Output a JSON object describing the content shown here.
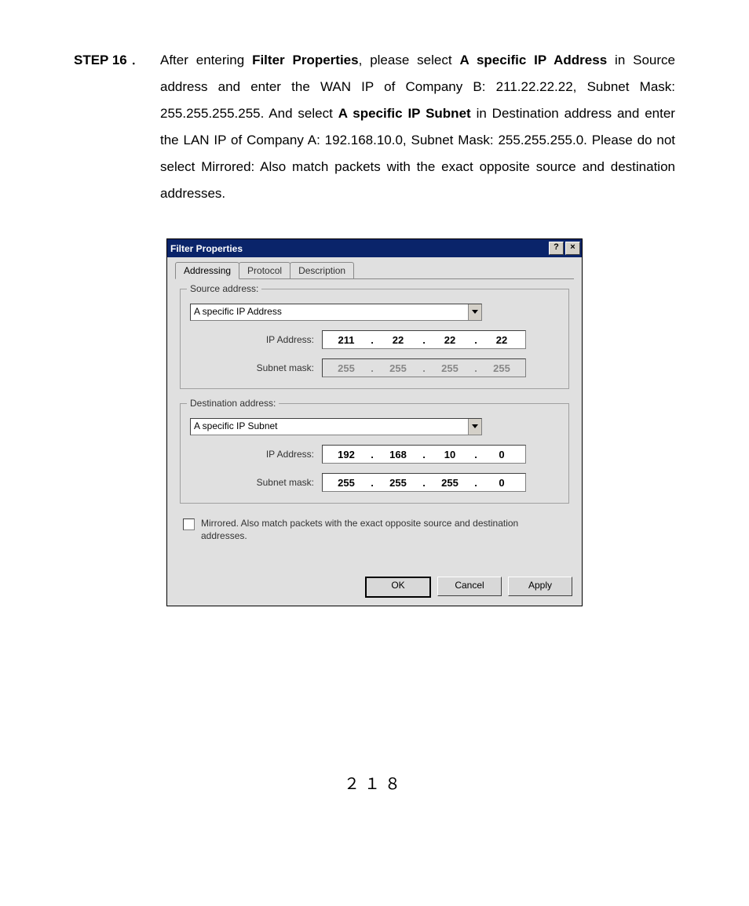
{
  "step": {
    "label": "STEP 16﹒",
    "text_pre": "After entering ",
    "bold1": "Filter Properties",
    "text_mid1": ", please select ",
    "bold2": "A specific IP Address",
    "text_mid2": " in Source address and enter the WAN IP of Company B: 211.22.22.22, Subnet Mask: 255.255.255.255. And select ",
    "bold3": "A specific IP Subnet",
    "text_mid3": " in Destination address and enter the LAN IP of Company A: 192.168.10.0, Subnet Mask: 255.255.255.0.   Please do not select Mirrored: Also match packets with the exact opposite source and destination addresses."
  },
  "dialog": {
    "title": "Filter Properties",
    "help_btn": "?",
    "close_btn": "×",
    "tabs": {
      "addressing": "Addressing",
      "protocol": "Protocol",
      "description": "Description"
    },
    "source": {
      "legend": "Source address:",
      "combo": "A specific IP Address",
      "ip_label": "IP Address:",
      "ip": [
        "211",
        "22",
        "22",
        "22"
      ],
      "mask_label": "Subnet mask:",
      "mask": [
        "255",
        "255",
        "255",
        "255"
      ]
    },
    "dest": {
      "legend": "Destination address:",
      "combo": "A specific IP Subnet",
      "ip_label": "IP Address:",
      "ip": [
        "192",
        "168",
        "10",
        "0"
      ],
      "mask_label": "Subnet mask:",
      "mask": [
        "255",
        "255",
        "255",
        "0"
      ]
    },
    "mirrored_label": "Mirrored. Also match packets with the exact opposite source and destination addresses.",
    "buttons": {
      "ok": "OK",
      "cancel": "Cancel",
      "apply": "Apply"
    }
  },
  "page_number": "２１８"
}
